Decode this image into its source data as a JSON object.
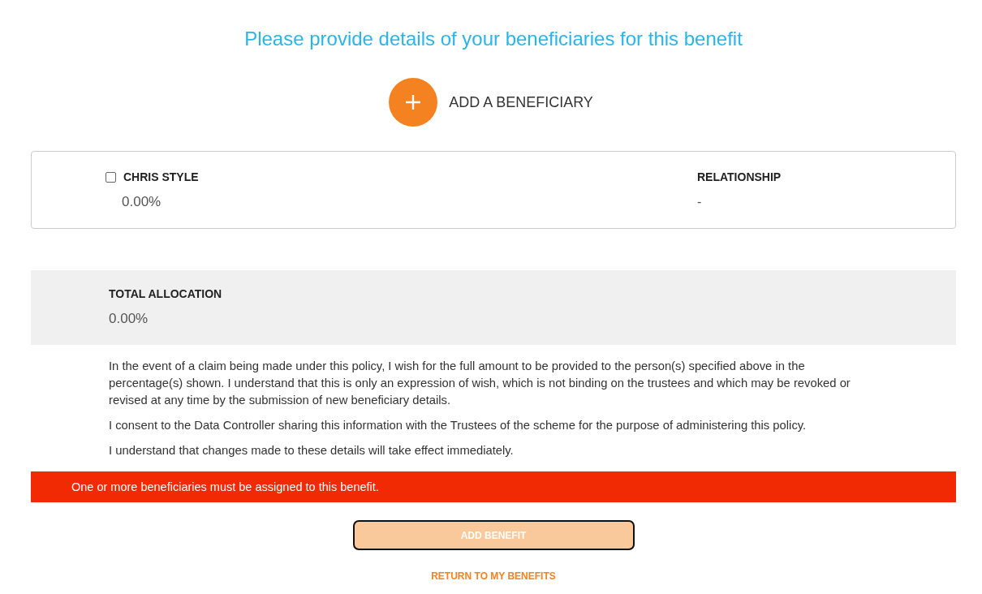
{
  "heading": "Please provide details of your beneficiaries for this benefit",
  "add_beneficiary": {
    "label": "ADD A BENEFICIARY"
  },
  "beneficiaries": [
    {
      "name": "CHRIS STYLE",
      "checked": false,
      "allocation": "0.00%",
      "relationship_label": "RELATIONSHIP",
      "relationship": "-"
    }
  ],
  "total": {
    "label": "TOTAL ALLOCATION",
    "value": "0.00%"
  },
  "declaration": [
    "In the event of a claim being made under this policy, I wish for the full amount to be provided to the person(s) specified above in the percentage(s) shown. I understand that this is only an expression of wish, which is not binding on the trustees and which may be revoked or revised at any time by the submission of new beneficiary details.",
    "I consent to the Data Controller sharing this information with the Trustees of the scheme for the purpose of administering this policy.",
    "I understand that changes made to these details will take effect immediately."
  ],
  "error": "One or more beneficiaries must be assigned to this benefit.",
  "primary_button": {
    "label": "ADD BENEFIT",
    "disabled": true,
    "focused": true
  },
  "link": "RETURN TO MY BENEFITS"
}
